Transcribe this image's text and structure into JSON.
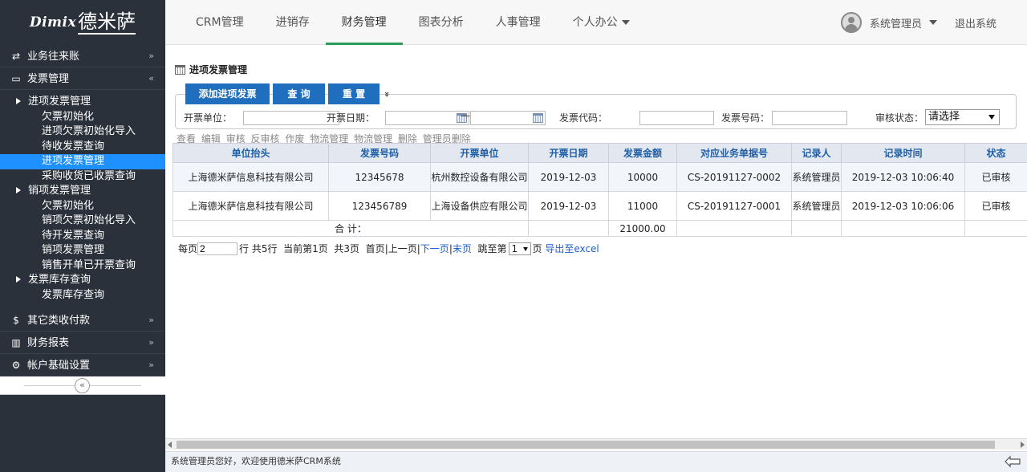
{
  "logo": {
    "latin": "Dimix",
    "chinese": "德米萨"
  },
  "nav": {
    "items": [
      "CRM管理",
      "进销存",
      "财务管理",
      "图表分析",
      "人事管理",
      "个人办公"
    ],
    "active_index": 2
  },
  "user": {
    "name": "系统管理员",
    "logout": "退出系统"
  },
  "sidebar": {
    "sections": [
      {
        "label": "业务往来账",
        "icon": "⇄"
      },
      {
        "label": "发票管理",
        "icon": "▭"
      },
      {
        "label": "其它类收付款",
        "icon": "$"
      },
      {
        "label": "财务报表",
        "icon": "▥"
      },
      {
        "label": "帐户基础设置",
        "icon": "⚙"
      }
    ],
    "tree": {
      "g1": "进项发票管理",
      "g1_items": [
        "欠票初始化",
        "进项欠票初始化导入",
        "待收发票查询",
        "进项发票管理",
        "采购收货已收票查询"
      ],
      "g2": "销项发票管理",
      "g2_items": [
        "欠票初始化",
        "销项欠票初始化导入",
        "待开发票查询",
        "销项发票管理",
        "销售开单已开票查询"
      ],
      "g3": "发票库存查询",
      "g3_items": [
        "发票库存查询"
      ]
    },
    "collapse_icon": "«"
  },
  "page": {
    "title": "进项发票管理"
  },
  "toolbar": {
    "add": "添加进项发票",
    "query": "查 询",
    "reset": "重 置",
    "more": "»"
  },
  "search": {
    "unit_label": "开票单位：",
    "date_label": "开票日期：",
    "date_sep": "—",
    "code_label": "发票代码：",
    "number_label": "发票号码：",
    "status_label": "审核状态：",
    "status_value": "请选择"
  },
  "actions": [
    "查看",
    "编辑",
    "审核",
    "反审核",
    "作废",
    "物流管理",
    "物流管理",
    "删除",
    "管理员删除"
  ],
  "table": {
    "headers": [
      "单位抬头",
      "发票号码",
      "开票单位",
      "开票日期",
      "发票金额",
      "对应业务单据号",
      "记录人",
      "记录时间",
      "状态"
    ],
    "rows": [
      [
        "上海德米萨信息科技有限公司",
        "12345678",
        "杭州数控设备有限公司",
        "2019-12-03",
        "10000",
        "CS-20191127-0002",
        "系统管理员",
        "2019-12-03 10:06:40",
        "已审核"
      ],
      [
        "上海德米萨信息科技有限公司",
        "123456789",
        "上海设备供应有限公司",
        "2019-12-03",
        "11000",
        "CS-20191127-0001",
        "系统管理员",
        "2019-12-03 10:06:06",
        "已审核"
      ]
    ],
    "total_label": "合 计：",
    "total_value": "21000.00"
  },
  "pager": {
    "per_page_label": "每页",
    "per_page_value": "2",
    "rows_text": "行 共5行",
    "current_text": "当前第1页",
    "pages_text": "共3页",
    "first": "首页",
    "prev": "上一页",
    "next": "下一页",
    "last": "末页",
    "jump_label": "跳至第",
    "jump_value": "1",
    "page_suffix": "页",
    "export": "导出至excel"
  },
  "status_bar": {
    "text": "系统管理员您好，欢迎使用德米萨CRM系统"
  }
}
